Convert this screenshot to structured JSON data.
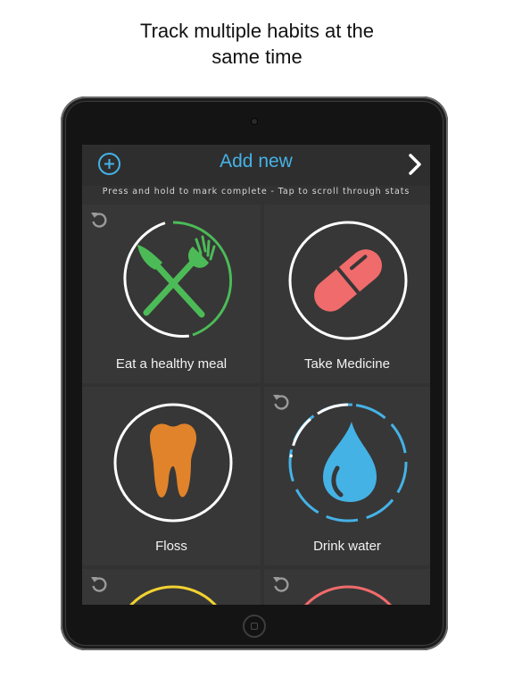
{
  "caption": {
    "line1": "Track multiple habits at the",
    "line2": "same time"
  },
  "app": {
    "title": "Add new",
    "hint": "Press and hold to mark complete  -  Tap to scroll through stats",
    "colors": {
      "accent": "#45b2e6",
      "green": "#4cbb57",
      "red": "#f06b6b",
      "orange": "#e0832a",
      "blue": "#45b2e6",
      "yellow": "#f2d230"
    }
  },
  "habits": [
    {
      "name": "Eat a healthy meal",
      "icon": "fork-knife-icon",
      "color": "#4cbb57",
      "progress_ring": "partial"
    },
    {
      "name": "Take Medicine",
      "icon": "pill-icon",
      "color": "#f06b6b",
      "progress_ring": "complete"
    },
    {
      "name": "Floss",
      "icon": "tooth-icon",
      "color": "#e0832a",
      "progress_ring": "complete"
    },
    {
      "name": "Drink water",
      "icon": "water-drop-icon",
      "color": "#45b2e6",
      "progress_ring": "partial"
    },
    {
      "name": "",
      "icon": "",
      "color": "#f2d230",
      "progress_ring": "partial"
    },
    {
      "name": "",
      "icon": "",
      "color": "#f06b6b",
      "progress_ring": "partial"
    }
  ]
}
